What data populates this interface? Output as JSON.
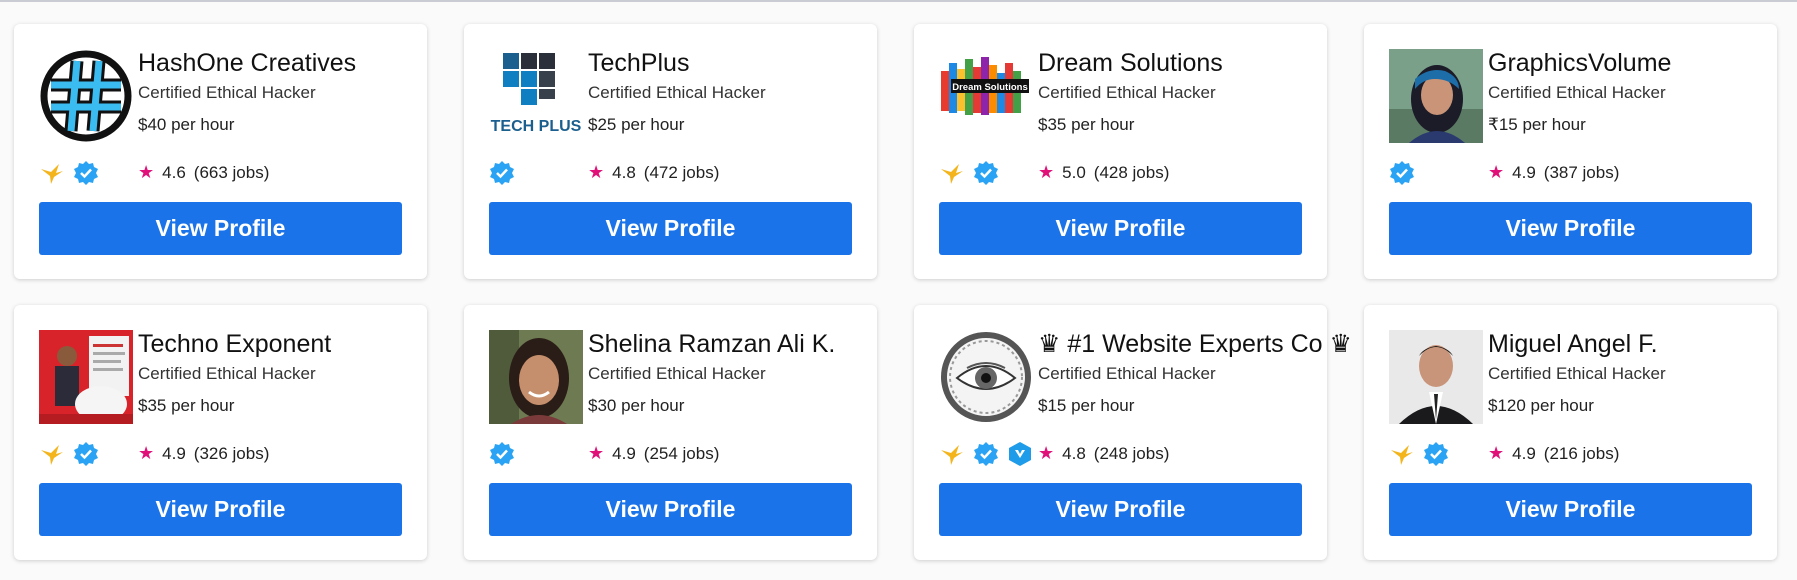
{
  "colors": {
    "button": "#1a73e8",
    "star": "#e0127a",
    "verified": "#2ba3f5",
    "hummingbird": "#f3b51b"
  },
  "cards": [
    {
      "name": "HashOne Creatives",
      "title": "Certified Ethical Hacker",
      "rate": "$40 per hour",
      "rating": "4.6",
      "jobs": "(663 jobs)",
      "button": "View Profile",
      "avatar": "hash-logo",
      "badges": [
        "hummingbird-icon",
        "verified-icon"
      ]
    },
    {
      "name": "TechPlus",
      "title": "Certified Ethical Hacker",
      "rate": "$25 per hour",
      "rating": "4.8",
      "jobs": "(472 jobs)",
      "button": "View Profile",
      "avatar": "techplus-logo",
      "logo_text": "TECH PLUS",
      "badges": [
        "verified-icon"
      ]
    },
    {
      "name": "Dream Solutions",
      "title": "Certified Ethical Hacker",
      "rate": "$35 per hour",
      "rating": "5.0",
      "jobs": "(428 jobs)",
      "button": "View Profile",
      "avatar": "dream-solutions-logo",
      "logo_text": "Dream Solutions",
      "badges": [
        "hummingbird-icon",
        "verified-icon"
      ]
    },
    {
      "name": "GraphicsVolume",
      "title": "Certified Ethical Hacker",
      "rate": "₹15 per hour",
      "rating": "4.9",
      "jobs": "(387 jobs)",
      "button": "View Profile",
      "avatar": "woman-photo",
      "badges": [
        "verified-icon"
      ]
    },
    {
      "name": "Techno Exponent",
      "title": "Certified Ethical Hacker",
      "rate": "$35 per hour",
      "rating": "4.9",
      "jobs": "(326 jobs)",
      "button": "View Profile",
      "avatar": "man-banner-photo",
      "badges": [
        "hummingbird-icon",
        "verified-icon"
      ]
    },
    {
      "name": "Shelina Ramzan Ali K.",
      "title": "Certified Ethical Hacker",
      "rate": "$30 per hour",
      "rating": "4.9",
      "jobs": "(254 jobs)",
      "button": "View Profile",
      "avatar": "woman-smiling-photo",
      "badges": [
        "verified-icon"
      ]
    },
    {
      "name": "♛ #1 Website Experts Co ♛",
      "title": "Certified Ethical Hacker",
      "rate": "$15 per hour",
      "rating": "4.8",
      "jobs": "(248 jobs)",
      "button": "View Profile",
      "avatar": "eye-serpent-logo",
      "badges": [
        "hummingbird-icon",
        "verified-icon",
        "shield-icon"
      ]
    },
    {
      "name": "Miguel Angel F.",
      "title": "Certified Ethical Hacker",
      "rate": "$120 per hour",
      "rating": "4.9",
      "jobs": "(216 jobs)",
      "button": "View Profile",
      "avatar": "man-suit-photo",
      "badges": [
        "hummingbird-icon",
        "verified-icon"
      ]
    }
  ]
}
